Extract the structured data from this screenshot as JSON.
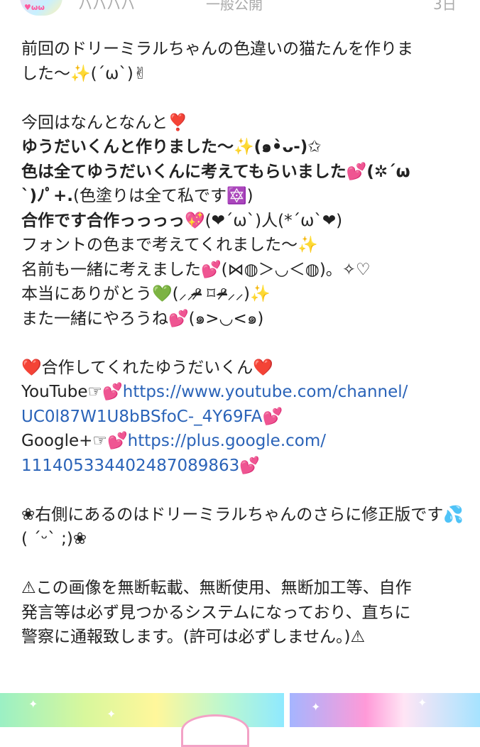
{
  "header": {
    "avatar_text": "♥ωω",
    "top_left_text": "ハハハハ",
    "top_mid_text": "一般公開",
    "top_right_text": "3日"
  },
  "post": {
    "l1": "前回のドリーミラルちゃんの色違いの猫たんを作りま",
    "l2": "した〜✨(´ω`)✌",
    "l4": "今回はなんとなんと❣️",
    "l5": "ゆうだいくんと作りました〜✨(๑•̀ᴗ-)✩",
    "l6": "色は全てゆうだいくんに考えてもらいました💕(✲´ω",
    "l7a": "`)ﾉﾟ+.",
    "l7b": "(色塗りは全て私です🔯)",
    "l8a": "合作です合作っっっっ💖",
    "l8b": "(❤´ω`)人(*´ω`❤)",
    "l9": "フォントの色まで考えてくれました〜✨",
    "l10": "名前も一緒に考えました💕(⋈◍＞◡＜◍)。✧♡",
    "l11": "本当にありがとう💚(⸝⸝ᵒ̴̶̷ ⌑ ᵒ̴̶̷⸝⸝)✨",
    "l12": "また一緒にやろうね💕(๑>◡<๑)",
    "l14": "❤️合作してくれたゆうだいくん❤️",
    "yt_label": "YouTube☞💕",
    "yt_link1": "https://www.youtube.com/channel/",
    "yt_link2": "UC0l87W1U8bBSfoC-_4Y69FA",
    "yt_tail": "💕",
    "g_label": "Google+☞💕",
    "g_link1": "https://plus.google.com/",
    "g_link2": "111405334402487089863",
    "g_tail": "💕",
    "l20": "❀右側にあるのはドリーミラルちゃんのさらに修正版です💦",
    "l21": "( ´ᵕ` ;)❀",
    "l23": "⚠この画像を無断転載、無断使用、無断加工等、自作",
    "l24": "発言等は必ず見つかるシステムになっており、直ちに",
    "l25": "警察に通報致します。(許可は必ずしません。)⚠"
  },
  "thumbs": {
    "sparkle": "✦"
  }
}
